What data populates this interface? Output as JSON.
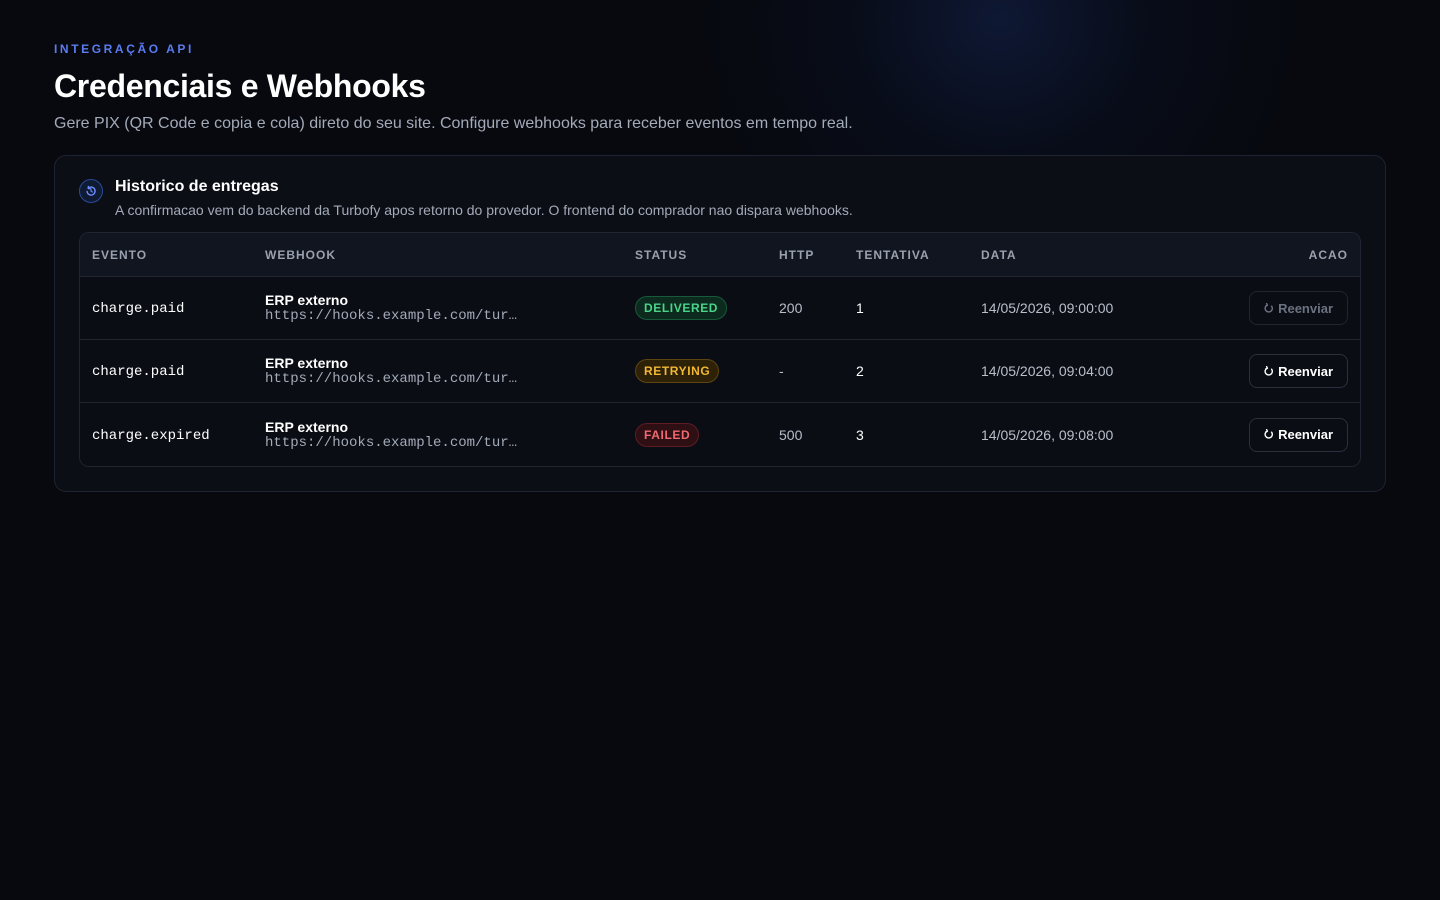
{
  "header": {
    "eyebrow": "INTEGRAÇÃO API",
    "title": "Credenciais e Webhooks",
    "subtitle": "Gere PIX (QR Code e copia e cola) direto do seu site. Configure webhooks para receber eventos em tempo real."
  },
  "history": {
    "icon": "history-icon",
    "title": "Historico de entregas",
    "description": "A confirmacao vem do backend da Turbofy apos retorno do provedor. O frontend do comprador nao dispara webhooks.",
    "columns": {
      "event": "EVENTO",
      "webhook": "WEBHOOK",
      "status": "STATUS",
      "http": "HTTP",
      "attempt": "TENTATIVA",
      "date": "DATA",
      "action": "ACAO"
    },
    "rows": [
      {
        "event": "charge.paid",
        "webhook_name": "ERP externo",
        "webhook_url": "https://hooks.example.com/tur…",
        "status": "DELIVERED",
        "http": "200",
        "attempt": "1",
        "date": "14/05/2026, 09:00:00",
        "action": "Reenviar",
        "action_disabled": true
      },
      {
        "event": "charge.paid",
        "webhook_name": "ERP externo",
        "webhook_url": "https://hooks.example.com/tur…",
        "status": "RETRYING",
        "http": "-",
        "attempt": "2",
        "date": "14/05/2026, 09:04:00",
        "action": "Reenviar",
        "action_disabled": false
      },
      {
        "event": "charge.expired",
        "webhook_name": "ERP externo",
        "webhook_url": "https://hooks.example.com/tur…",
        "status": "FAILED",
        "http": "500",
        "attempt": "3",
        "date": "14/05/2026, 09:08:00",
        "action": "Reenviar",
        "action_disabled": false
      }
    ]
  },
  "colors": {
    "accent": "#5b7cf0",
    "delivered": "#4ad48a",
    "retrying": "#f2b733",
    "failed": "#f06a72"
  }
}
